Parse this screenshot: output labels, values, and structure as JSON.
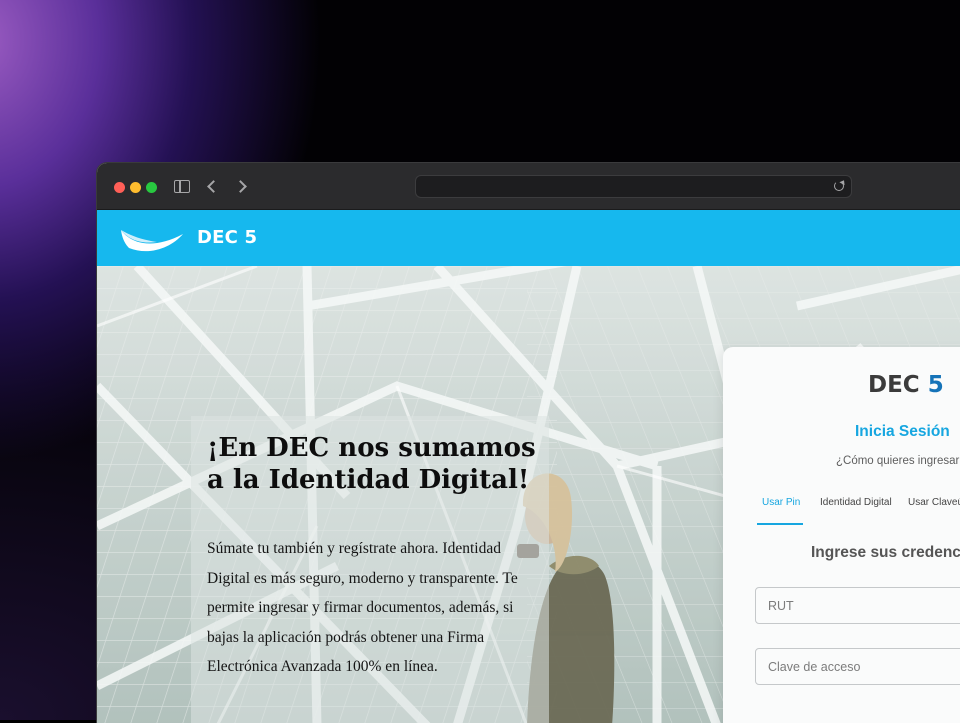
{
  "site": {
    "brand_name": "DEC 5",
    "brand_color": "#16b8ee"
  },
  "browser": {
    "url": ""
  },
  "hero": {
    "title": "¡En DEC nos sumamos a la Identidad Digital!",
    "body": "Súmate tu también y regístrate ahora. Identidad Digital es más seguro, moderno y transparente. Te permite ingresar y firmar documentos, además, si bajas la aplicación podrás obtener una Firma Electrónica Avanzada 100% en línea."
  },
  "login": {
    "logo_text": "DEC",
    "logo_number": "5",
    "title": "Inicia Sesión",
    "subtitle": "¿Cómo quieres ingresar",
    "tabs": [
      {
        "label": "Usar Pin",
        "active": true
      },
      {
        "label": "Identidad Digital",
        "active": false
      },
      {
        "label": "Usar Claveú",
        "active": false
      }
    ],
    "form_heading": "Ingrese sus credenci",
    "rut_placeholder": "RUT",
    "password_placeholder": "Clave de acceso"
  }
}
